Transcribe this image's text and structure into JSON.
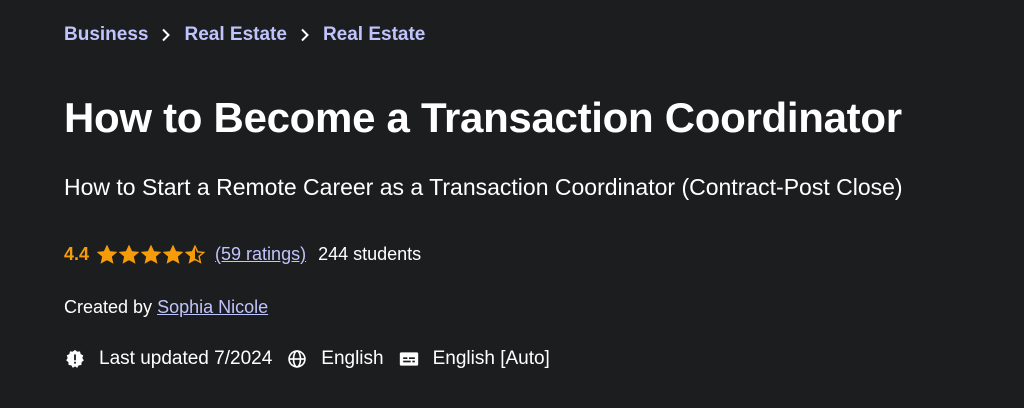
{
  "breadcrumb": {
    "items": [
      "Business",
      "Real Estate",
      "Real Estate"
    ]
  },
  "course": {
    "title": "How to Become a Transaction Coordinator",
    "subtitle": "How to Start a Remote Career as a Transaction Coordinator (Contract-Post Close)"
  },
  "rating": {
    "value": "4.4",
    "stars": 4.4,
    "ratings_text": "(59 ratings)",
    "students_text": "244 students"
  },
  "creator": {
    "prefix": "Created by",
    "name": "Sophia Nicole"
  },
  "meta": {
    "last_updated": "Last updated 7/2024",
    "language": "English",
    "captions": "English [Auto]"
  },
  "colors": {
    "background": "#1c1d1f",
    "link": "#c0c4fc",
    "star": "#f69c08"
  },
  "icons": {
    "chevron": "chevron-right-icon",
    "updated": "badge-alert-icon",
    "language": "globe-icon",
    "captions": "closed-captions-icon"
  }
}
